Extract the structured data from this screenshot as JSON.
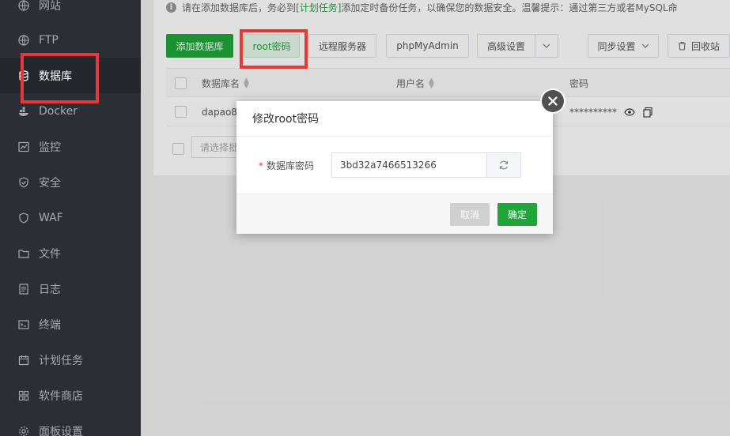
{
  "sidebar": {
    "items": [
      {
        "label": "网站",
        "icon": "globe-icon"
      },
      {
        "label": "FTP",
        "icon": "globe-icon"
      },
      {
        "label": "数据库",
        "icon": "database-icon"
      },
      {
        "label": "Docker",
        "icon": "docker-icon"
      },
      {
        "label": "监控",
        "icon": "monitor-icon"
      },
      {
        "label": "安全",
        "icon": "shield-icon"
      },
      {
        "label": "WAF",
        "icon": "shield-icon"
      },
      {
        "label": "文件",
        "icon": "folder-icon"
      },
      {
        "label": "日志",
        "icon": "log-icon"
      },
      {
        "label": "终端",
        "icon": "terminal-icon"
      },
      {
        "label": "计划任务",
        "icon": "calendar-icon"
      },
      {
        "label": "软件商店",
        "icon": "grid-icon"
      },
      {
        "label": "面板设置",
        "icon": "gear-icon"
      }
    ],
    "active": "数据库"
  },
  "notice": {
    "prefix": "请在添加数据库后，务必到",
    "link": "[计划任务]",
    "suffix": "添加定时备份任务，以确保您的数据安全。温馨提示：通过第三方或者MySQL命"
  },
  "toolbar": {
    "add_db": "添加数据库",
    "root_pwd": "root密码",
    "remote_server": "远程服务器",
    "phpmyadmin": "phpMyAdmin",
    "advanced": "高级设置",
    "sync": "同步设置",
    "recycle": "回收站"
  },
  "table": {
    "headers": {
      "name": "数据库名",
      "user": "用户名",
      "password": "密码"
    },
    "rows": [
      {
        "name": "dapao8",
        "password": "**********"
      }
    ]
  },
  "batch": {
    "placeholder": "请选择批"
  },
  "dialog": {
    "title": "修改root密码",
    "field_label": "数据库密码",
    "required_mark": "*",
    "password_value": "3bd32a7466513266",
    "cancel": "取消",
    "ok": "确定"
  },
  "colors": {
    "brand": "#20a53a",
    "highlight": "#e53935",
    "sidebar_bg": "#2b2f35"
  }
}
